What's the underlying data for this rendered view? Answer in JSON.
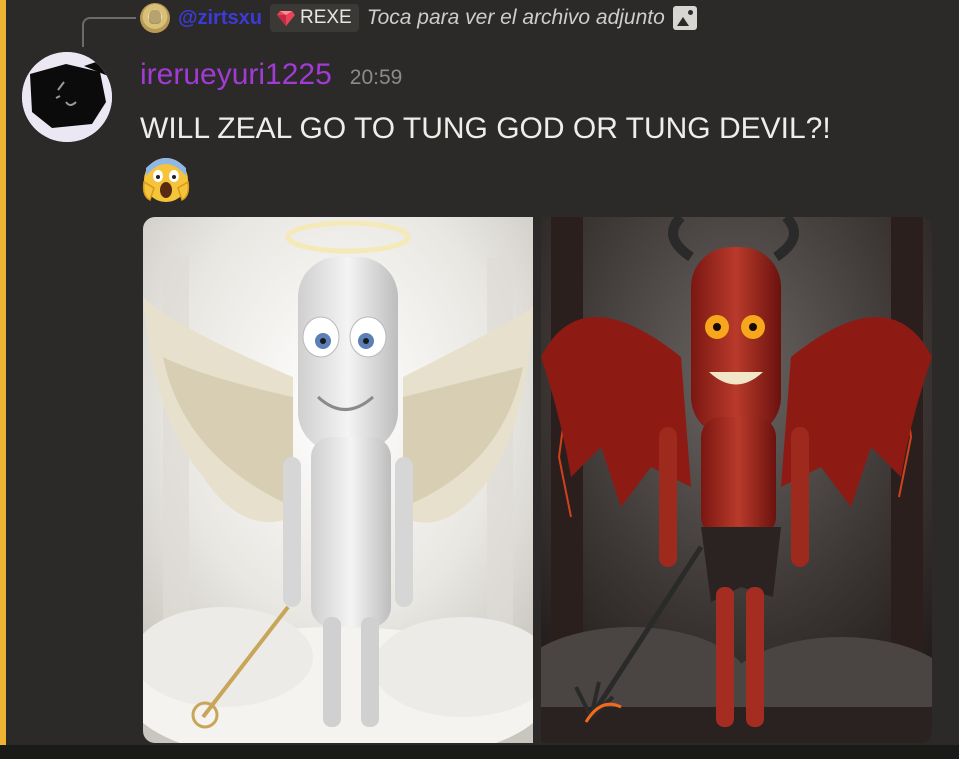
{
  "reply": {
    "username": "@zirtsxu",
    "role_badge": "REXE",
    "preview_text": "Toca para ver el archivo adjunto",
    "icons": [
      "gem-icon",
      "image-icon"
    ]
  },
  "message": {
    "username": "irerueyuri1225",
    "timestamp": "20:59",
    "text": "WILL ZEAL GO TO TUNG GOD OR TUNG DEVIL?!",
    "emoji": "screaming-face"
  },
  "attachments": [
    {
      "subject": "angel-figure"
    },
    {
      "subject": "devil-figure"
    }
  ],
  "colors": {
    "highlight_bar": "#f0b232",
    "background": "#2b2a28",
    "username": "#a23ad6",
    "reply_username": "#3b3bd8",
    "timestamp": "#8d8b88",
    "message_text": "#efedea"
  }
}
